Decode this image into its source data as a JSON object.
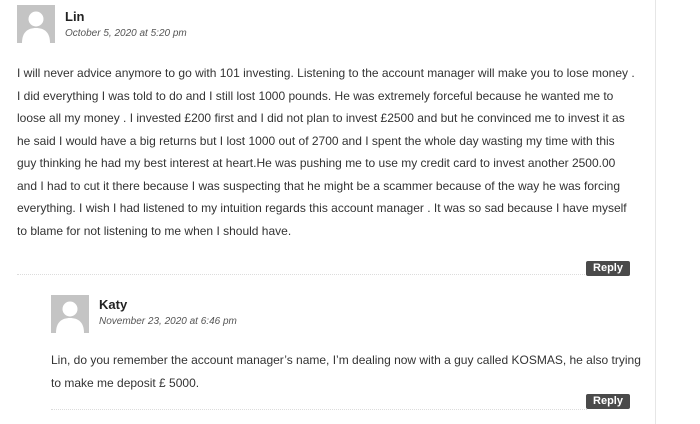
{
  "comments": [
    {
      "author": "Lin",
      "date": "October 5, 2020 at 5:20 pm",
      "avatar_icon": "default-avatar-icon",
      "body": "I will never advice anymore to go with 101 investing. Listening to the account manager will make you to lose money . I did everything I was told to do and I still lost 1000 pounds. He was extremely forceful because he wanted me to loose all my money . I invested £200 first and I did not plan to invest £2500 and but he convinced me to invest it as he said I would have a big returns but I lost 1000 out of 2700 and I spent the whole day wasting my time with this guy thinking he had my best interest at heart.He was pushing me to use my credit card to invest another 2500.00 and I had to cut it there because I was suspecting that he might be a scammer because of the way he was forcing everything. I wish I had listened to my intuition regards this account manager . It was so sad because I have myself to blame for not listening to me when I should have.",
      "reply_label": "Reply"
    },
    {
      "author": "Katy",
      "date": "November 23, 2020 at 6:46 pm",
      "avatar_icon": "default-avatar-icon",
      "body": "Lin, do you remember the account manager’s name, I’m dealing now with a guy called KOSMAS, he also trying to make me deposit £ 5000.",
      "reply_label": "Reply"
    }
  ],
  "colors": {
    "avatar_bg": "#c4c4c4",
    "avatar_fg": "#ffffff",
    "reply_bg": "#4a4a4a",
    "reply_text": "#ffffff",
    "text": "#333333",
    "date_text": "#555555"
  }
}
